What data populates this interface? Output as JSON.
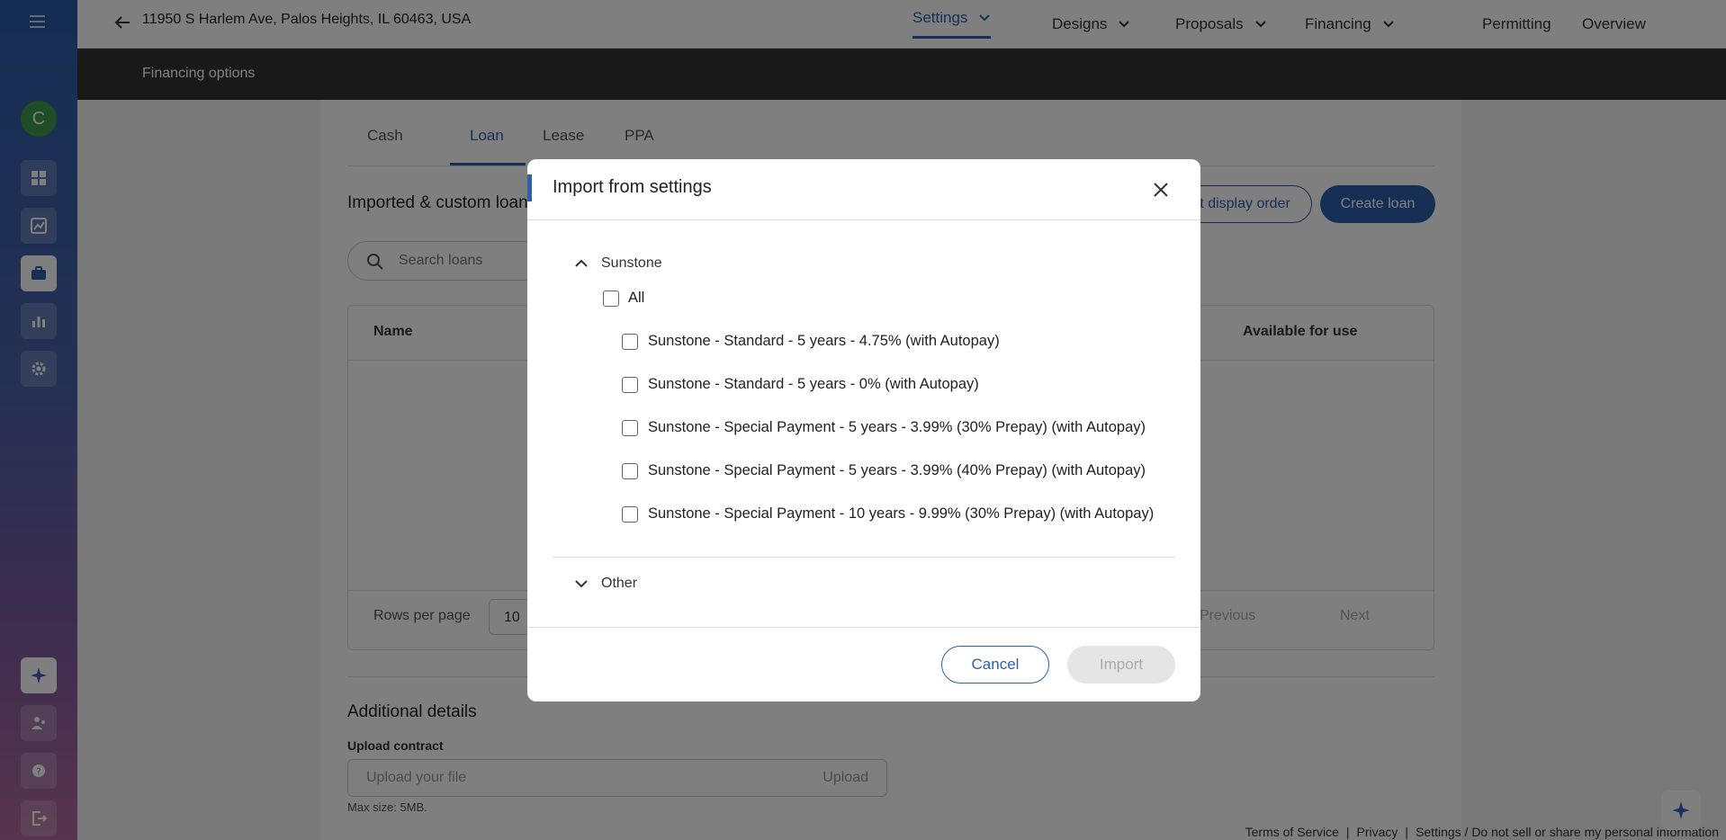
{
  "sidebar": {
    "avatar_letter": "C",
    "items": [
      {
        "icon": "dashboard-icon"
      },
      {
        "icon": "chart-trend-icon"
      },
      {
        "icon": "briefcase-icon"
      },
      {
        "icon": "bar-chart-icon"
      },
      {
        "icon": "gear-icon"
      }
    ],
    "bottom_items": [
      {
        "icon": "sparkle-icon"
      },
      {
        "icon": "users-icon"
      },
      {
        "icon": "help-icon"
      },
      {
        "icon": "logout-icon"
      }
    ]
  },
  "topbar": {
    "address": "11950 S Harlem Ave, Palos Heights, IL 60463, USA",
    "nav": [
      {
        "label": "Settings",
        "active": true
      },
      {
        "label": "Designs"
      },
      {
        "label": "Proposals"
      },
      {
        "label": "Financing"
      },
      {
        "label": "Permitting"
      },
      {
        "label": "Overview"
      }
    ]
  },
  "subheader": {
    "title": "Financing options"
  },
  "content": {
    "tabs": [
      "Cash",
      "Loan",
      "Lease",
      "PPA"
    ],
    "section_title": "Imported & custom loans",
    "display_order_btn": "Edit display order",
    "create_btn": "Create loan",
    "search_placeholder": "Search loans",
    "table": {
      "col_name": "Name",
      "col_available": "Available for use",
      "rows_per_page_label": "Rows per page",
      "rows_per_page_value": "10",
      "prev": "Previous",
      "next": "Next"
    },
    "additional_title": "Additional details",
    "upload_label": "Upload contract",
    "upload_placeholder": "Upload your file",
    "upload_btn": "Upload",
    "max_size": "Max size: 5MB."
  },
  "footer": {
    "terms": "Terms of Service",
    "privacy": "Privacy",
    "settings": "Settings / Do not sell or share my personal information"
  },
  "modal": {
    "title": "Import from settings",
    "groups": [
      {
        "name": "Sunstone",
        "expanded": true,
        "all_label": "All",
        "options": [
          "Sunstone - Standard - 5 years - 4.75% (with Autopay)",
          "Sunstone - Standard - 5 years - 0% (with Autopay)",
          "Sunstone - Special Payment - 5 years - 3.99% (30% Prepay) (with Autopay)",
          "Sunstone - Special Payment - 5 years - 3.99% (40% Prepay) (with Autopay)",
          "Sunstone - Special Payment - 10 years - 9.99% (30% Prepay) (with Autopay)"
        ]
      },
      {
        "name": "Other",
        "expanded": false
      }
    ],
    "cancel": "Cancel",
    "import": "Import"
  }
}
